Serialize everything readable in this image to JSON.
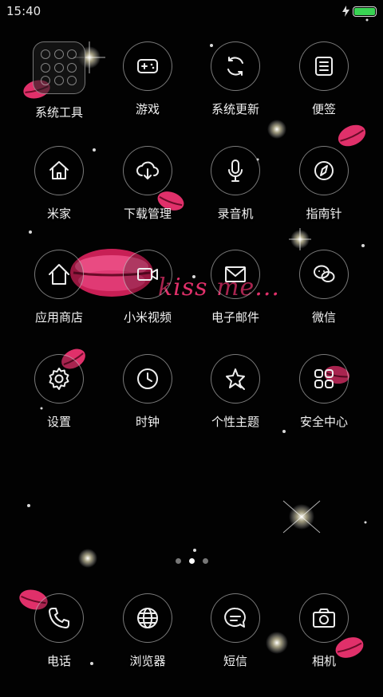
{
  "status": {
    "time": "15:40",
    "battery_level": 1.0
  },
  "apps": [
    {
      "label": "系统工具",
      "icon": "folder-icon",
      "name": "app-system-tools"
    },
    {
      "label": "游戏",
      "icon": "gamepad-icon",
      "name": "app-games"
    },
    {
      "label": "系统更新",
      "icon": "refresh-icon",
      "name": "app-system-update"
    },
    {
      "label": "便签",
      "icon": "notes-icon",
      "name": "app-notes"
    },
    {
      "label": "米家",
      "icon": "home-icon",
      "name": "app-mijia"
    },
    {
      "label": "下载管理",
      "icon": "cloud-download-icon",
      "name": "app-downloads"
    },
    {
      "label": "录音机",
      "icon": "microphone-icon",
      "name": "app-recorder"
    },
    {
      "label": "指南针",
      "icon": "compass-icon",
      "name": "app-compass"
    },
    {
      "label": "应用商店",
      "icon": "store-home-icon",
      "name": "app-store"
    },
    {
      "label": "小米视频",
      "icon": "video-icon",
      "name": "app-video"
    },
    {
      "label": "电子邮件",
      "icon": "mail-icon",
      "name": "app-email"
    },
    {
      "label": "微信",
      "icon": "wechat-icon",
      "name": "app-wechat"
    },
    {
      "label": "设置",
      "icon": "gear-icon",
      "name": "app-settings"
    },
    {
      "label": "时钟",
      "icon": "clock-icon",
      "name": "app-clock"
    },
    {
      "label": "个性主题",
      "icon": "theme-star-icon",
      "name": "app-themes"
    },
    {
      "label": "安全中心",
      "icon": "security-grid-icon",
      "name": "app-security"
    }
  ],
  "dock": [
    {
      "label": "电话",
      "icon": "phone-icon",
      "name": "dock-phone"
    },
    {
      "label": "浏览器",
      "icon": "globe-icon",
      "name": "dock-browser"
    },
    {
      "label": "短信",
      "icon": "message-icon",
      "name": "dock-messages"
    },
    {
      "label": "相机",
      "icon": "camera-icon",
      "name": "dock-camera"
    }
  ],
  "pages": {
    "count": 3,
    "active": 1
  },
  "wallpaper": {
    "text": "kiss me...",
    "accent": "#e0306a"
  }
}
